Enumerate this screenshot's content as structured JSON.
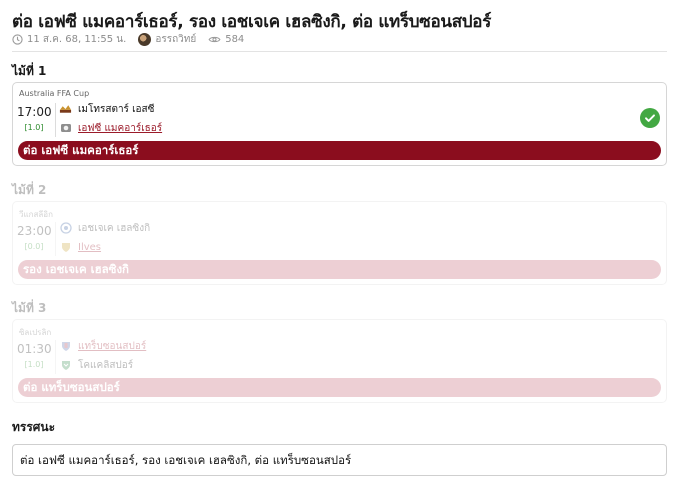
{
  "article": {
    "title": "ต่อ เอฟซี แมคอาร์เธอร์, รอง เอชเจเค เฮลซิงกิ, ต่อ แทร็บซอนสปอร์",
    "date": "11 ส.ค. 68, 11:55 น.",
    "author": "อรรถวิทย์",
    "views": "584"
  },
  "picks": [
    {
      "label": "ไม้ที่ 1",
      "league": "Australia FFA Cup",
      "time": "17:00",
      "odds": "[1.0]",
      "home": {
        "name": "เมโทรสตาร์ เอสซี",
        "logo_icon": "club-crest-icon"
      },
      "away": {
        "name": "เอฟซี แมคอาร์เธอร์",
        "logo_icon": "club-crest-icon"
      },
      "picked_side": "away",
      "bet": "ต่อ เอฟซี แมคอาร์เธอร์",
      "result": "win",
      "result_icon": "check-icon"
    },
    {
      "label": "ไม้ที่ 2",
      "league": "วีแกสลีอิก",
      "time": "23:00",
      "odds": "[0.0]",
      "home": {
        "name": "เอชเจเค เฮลซิงกิ",
        "logo_icon": "club-crest-icon"
      },
      "away": {
        "name": "Ilves",
        "logo_icon": "club-crest-icon"
      },
      "picked_side": "away",
      "bet": "รอง เอชเจเค เฮลซิงกิ"
    },
    {
      "label": "ไม้ที่ 3",
      "league": "ซิลเปรลิก",
      "time": "01:30",
      "odds": "[1.0]",
      "home": {
        "name": "แทร็บซอนสปอร์",
        "logo_icon": "club-crest-icon"
      },
      "away": {
        "name": "โคแคลิสปอร์",
        "logo_icon": "club-crest-icon"
      },
      "picked_side": "home",
      "bet": "ต่อ แทร็บซอนสปอร์"
    }
  ],
  "analysis": {
    "label": "ทรรศนะ",
    "text": "ต่อ เอฟซี แมคอาร์เธอร์, รอง เอชเจเค เฮลซิงกิ, ต่อ แทร็บซอนสปอร์"
  },
  "colors": {
    "bet_bar": "#8b0d1e",
    "pick_link": "#9b1b2a",
    "odds": "#2e8b2e",
    "win_check": "#43a843"
  }
}
